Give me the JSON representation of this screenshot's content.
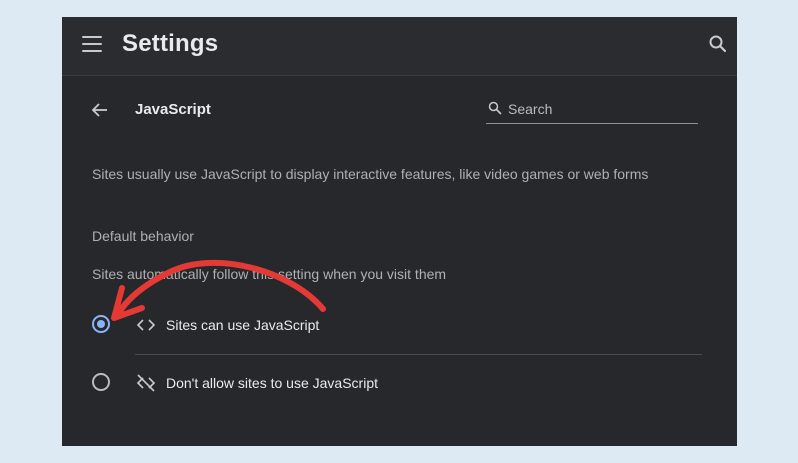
{
  "header": {
    "title": "Settings"
  },
  "page": {
    "title": "JavaScript",
    "search_placeholder": "Search",
    "description": "Sites usually use JavaScript to display interactive features, like video games or web forms",
    "section_heading": "Default behavior",
    "section_subtext": "Sites automatically follow this setting when you visit them"
  },
  "options": [
    {
      "label": "Sites can use JavaScript",
      "icon": "code-icon",
      "selected": true
    },
    {
      "label": "Don't allow sites to use JavaScript",
      "icon": "code-off-icon",
      "selected": false
    }
  ],
  "colors": {
    "accent": "#8ab4f8",
    "annotation": "#e53935",
    "background": "#27282c",
    "page_backdrop": "#dde9f3"
  }
}
